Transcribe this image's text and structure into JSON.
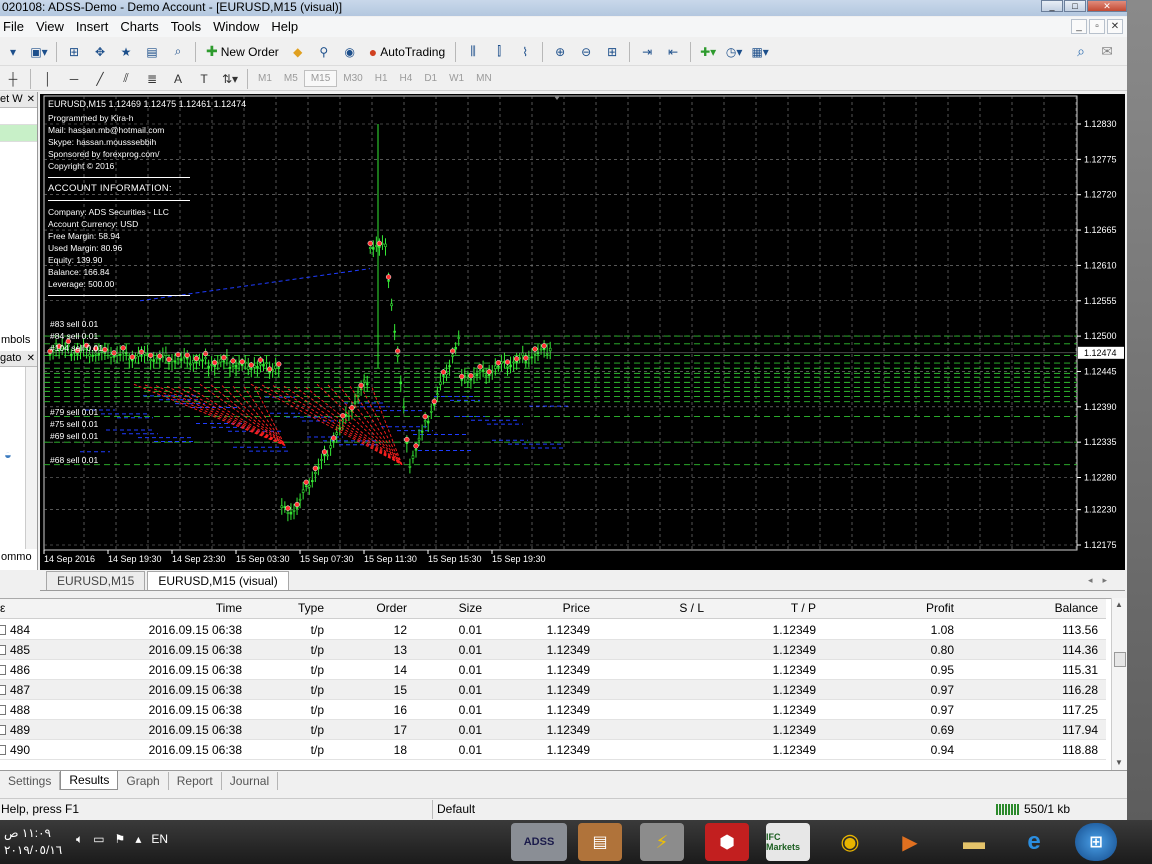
{
  "window": {
    "title": "020108: ADSS-Demo - Demo Account - [EURUSD,M15 (visual)]",
    "btn_minimize": "_",
    "btn_maximize": "□",
    "btn_close": "✕"
  },
  "menu": [
    "File",
    "View",
    "Insert",
    "Charts",
    "Tools",
    "Window",
    "Help"
  ],
  "mdi_buttons": [
    "_",
    "▫",
    "✕"
  ],
  "toolbar": {
    "new_order": "New Order",
    "autotrading": "AutoTrading",
    "timeframes": [
      "M1",
      "M5",
      "M15",
      "M30",
      "H1",
      "H4",
      "D1",
      "W1",
      "MN"
    ],
    "active_timeframe": "M15"
  },
  "left_panels": {
    "market_watch_title": "et W",
    "symbols_label": "mbols",
    "navigator_title": "gato",
    "common_label": "ommo"
  },
  "chart": {
    "header": "EURUSD,M15  1.12469 1.12475 1.12461 1.12474",
    "current_price": "1.12474",
    "price_labels": [
      "1.12830",
      "1.12775",
      "1.12720",
      "1.12665",
      "1.12610",
      "1.12555",
      "1.12500",
      "1.12445",
      "1.12390",
      "1.12335",
      "1.12280",
      "1.12230",
      "1.12175"
    ],
    "time_labels": [
      "14 Sep 2016",
      "14 Sep 19:30",
      "14 Sep 23:30",
      "15 Sep 03:30",
      "15 Sep 07:30",
      "15 Sep 11:30",
      "15 Sep 15:30",
      "15 Sep 19:30"
    ],
    "overlay": {
      "programmer": "Programmed by Kira-h",
      "mail": "Mail: hassan.mb@hotmail.com",
      "skype": "Skype: hassan.mousssebbih",
      "sponsor": "Sponsored by forexprog.com/",
      "copyright": "Copyright © 2016",
      "account_header": "ACCOUNT INFORMATION:",
      "company": "Company:        ADS Securities - LLC",
      "currency": "Account Currency: USD",
      "free_margin": "Free Margin:  58.94",
      "used_margin": "Used Margin:  80.96",
      "equity": "Equity:        139.90",
      "balance": "Balance:       166.84",
      "leverage": "Leverage:        500.00"
    },
    "order_tags": [
      "#83 sell 0.01",
      "#84 sell 0.01",
      "#104 sell 0.01",
      "#79 sell 0.01",
      "#75 sell 0.01",
      "#69 sell 0.01",
      "#68 sell 0.01"
    ]
  },
  "chart_tabs": [
    "EURUSD,M15",
    "EURUSD,M15 (visual)"
  ],
  "results": {
    "columns": [
      "Time",
      "Type",
      "Order",
      "Size",
      "Price",
      "S / L",
      "T / P",
      "Profit",
      "Balance"
    ],
    "rows": [
      {
        "id": "484",
        "time": "2016.09.15 06:38",
        "type": "t/p",
        "order": "12",
        "size": "0.01",
        "price": "1.12349",
        "sl": "",
        "tp": "1.12349",
        "profit": "1.08",
        "balance": "113.56"
      },
      {
        "id": "485",
        "time": "2016.09.15 06:38",
        "type": "t/p",
        "order": "13",
        "size": "0.01",
        "price": "1.12349",
        "sl": "",
        "tp": "1.12349",
        "profit": "0.80",
        "balance": "114.36"
      },
      {
        "id": "486",
        "time": "2016.09.15 06:38",
        "type": "t/p",
        "order": "14",
        "size": "0.01",
        "price": "1.12349",
        "sl": "",
        "tp": "1.12349",
        "profit": "0.95",
        "balance": "115.31"
      },
      {
        "id": "487",
        "time": "2016.09.15 06:38",
        "type": "t/p",
        "order": "15",
        "size": "0.01",
        "price": "1.12349",
        "sl": "",
        "tp": "1.12349",
        "profit": "0.97",
        "balance": "116.28"
      },
      {
        "id": "488",
        "time": "2016.09.15 06:38",
        "type": "t/p",
        "order": "16",
        "size": "0.01",
        "price": "1.12349",
        "sl": "",
        "tp": "1.12349",
        "profit": "0.97",
        "balance": "117.25"
      },
      {
        "id": "489",
        "time": "2016.09.15 06:38",
        "type": "t/p",
        "order": "17",
        "size": "0.01",
        "price": "1.12349",
        "sl": "",
        "tp": "1.12349",
        "profit": "0.69",
        "balance": "117.94"
      },
      {
        "id": "490",
        "time": "2016.09.15 06:38",
        "type": "t/p",
        "order": "18",
        "size": "0.01",
        "price": "1.12349",
        "sl": "",
        "tp": "1.12349",
        "profit": "0.94",
        "balance": "118.88"
      }
    ]
  },
  "bottom_tabs": [
    "Settings",
    "Results",
    "Graph",
    "Report",
    "Journal"
  ],
  "active_bottom_tab": "Results",
  "status": {
    "help": "Help, press F1",
    "profile": "Default",
    "traffic": "550/1 kb"
  },
  "taskbar": {
    "time": "١١:٠٩ ص",
    "date": "٢٠١٩/٠٥/١٦",
    "lang": "EN",
    "apps": [
      "ADSS",
      "IFC Markets"
    ]
  },
  "colors": {
    "chart_bg": "#000000",
    "candle": "#35e835",
    "order_line": "#1f3cff",
    "level_line": "#30c030",
    "trade_line": "#ff2020"
  }
}
